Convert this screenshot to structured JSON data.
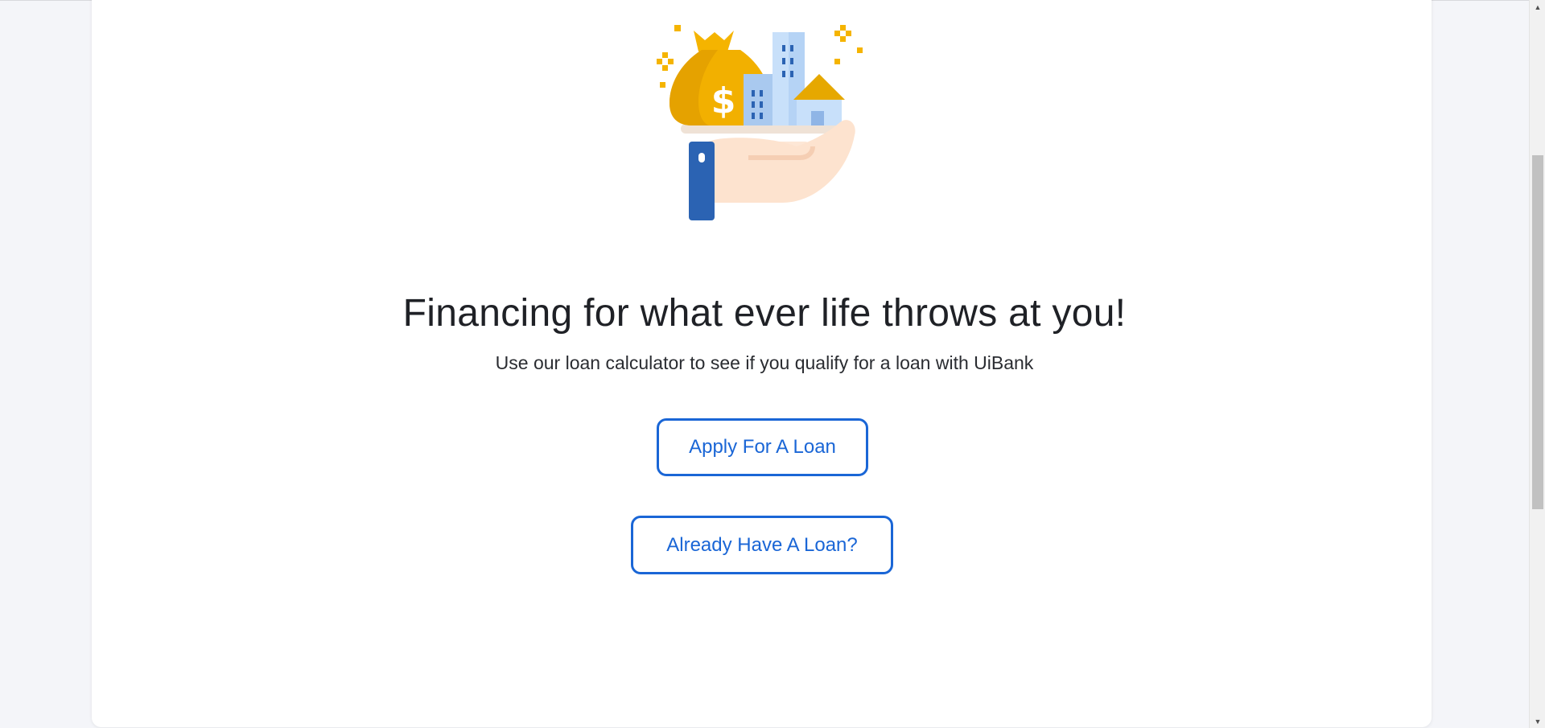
{
  "hero": {
    "illustration": "hand-holding-money-bag-buildings-house-icon",
    "headline": "Financing for what ever life throws at you!",
    "subtext": "Use our loan calculator to see if you qualify for a loan with UiBank"
  },
  "actions": {
    "apply_label": "Apply For A Loan",
    "existing_label": "Already Have A Loan?"
  },
  "scrollbar": {
    "up_icon": "triangle-up-icon",
    "down_icon": "triangle-down-icon"
  },
  "colors": {
    "accent": "#1a66d6",
    "page_background": "#f4f5f9",
    "card_background": "#ffffff",
    "headline": "#1f2126",
    "gold": "#f5b400",
    "sleeve_blue": "#2b63b3"
  }
}
